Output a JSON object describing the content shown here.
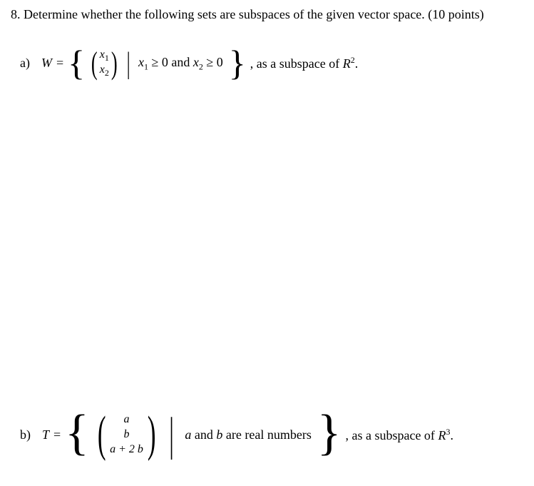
{
  "question": {
    "number": "8.",
    "prompt": "Determine whether the following sets are subspaces of the given vector space. (10 points)"
  },
  "partA": {
    "label": "a)",
    "setName": "W",
    "equals": "=",
    "vec": {
      "r1": "x",
      "r1sub": "1",
      "r2": "x",
      "r2sub": "2"
    },
    "cond_x1": "x",
    "cond_sub1": "1",
    "cond_ge1": "≥ 0 and ",
    "cond_x2": "x",
    "cond_sub2": "2",
    "cond_ge2": "≥ 0",
    "tail": ", as a subspace of ",
    "space": "R",
    "spaceSup": "2",
    "period": "."
  },
  "partB": {
    "label": "b)",
    "setName": "T",
    "equals": "=",
    "vec": {
      "r1": "a",
      "r2": "b",
      "r3": "a + 2 b"
    },
    "cond_a": "a",
    "cond_and": " and ",
    "cond_b": "b",
    "cond_rest": " are real numbers",
    "tail": ", as a subspace of ",
    "space": "R",
    "spaceSup": "3",
    "period": "."
  }
}
